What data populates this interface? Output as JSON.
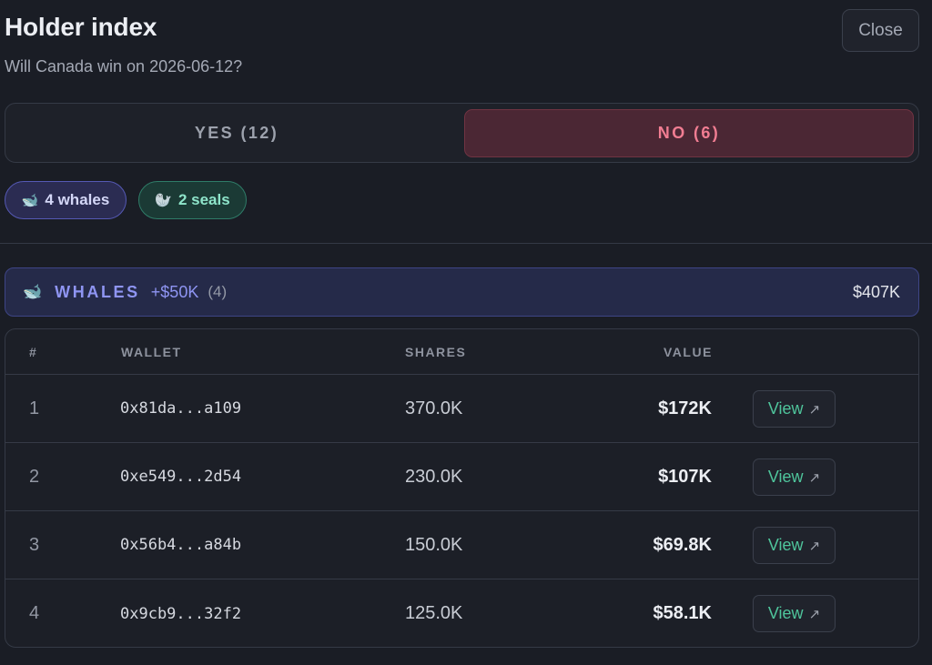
{
  "header": {
    "title": "Holder index",
    "subtitle": "Will Canada win on 2026-06-12?",
    "close_label": "Close"
  },
  "tabs": {
    "yes_label": "YES (12)",
    "no_label": "NO (6)",
    "active": "NO (6)"
  },
  "filters": [
    {
      "icon": "🐋",
      "label": "4 whales"
    },
    {
      "icon": "🦭",
      "label": "2 seals"
    }
  ],
  "group": {
    "icon": "🐋",
    "name": "WHALES",
    "range": "+$50K",
    "count": "(4)",
    "total": "$407K"
  },
  "table": {
    "columns": [
      "#",
      "WALLET",
      "SHARES",
      "VALUE"
    ],
    "rows": [
      {
        "rank": "1",
        "wallet": "0x81da...a109",
        "shares": "370.0K",
        "value": "$172K",
        "action": "View"
      },
      {
        "rank": "2",
        "wallet": "0xe549...2d54",
        "shares": "230.0K",
        "value": "$107K",
        "action": "View"
      },
      {
        "rank": "3",
        "wallet": "0x56b4...a84b",
        "shares": "150.0K",
        "value": "$69.8K",
        "action": "View"
      },
      {
        "rank": "4",
        "wallet": "0x9cb9...32f2",
        "shares": "125.0K",
        "value": "$58.1K",
        "action": "View"
      }
    ],
    "action_icon": "↗"
  },
  "colors": {
    "background": "#1a1d25",
    "no_accent": "#f17d92",
    "whale_accent": "#8f95f3",
    "seal_accent": "#8ee4ca",
    "link": "#4fc59c"
  },
  "icons": {
    "whale": "whale-icon",
    "seal": "seal-icon",
    "external": "external-link-icon"
  }
}
